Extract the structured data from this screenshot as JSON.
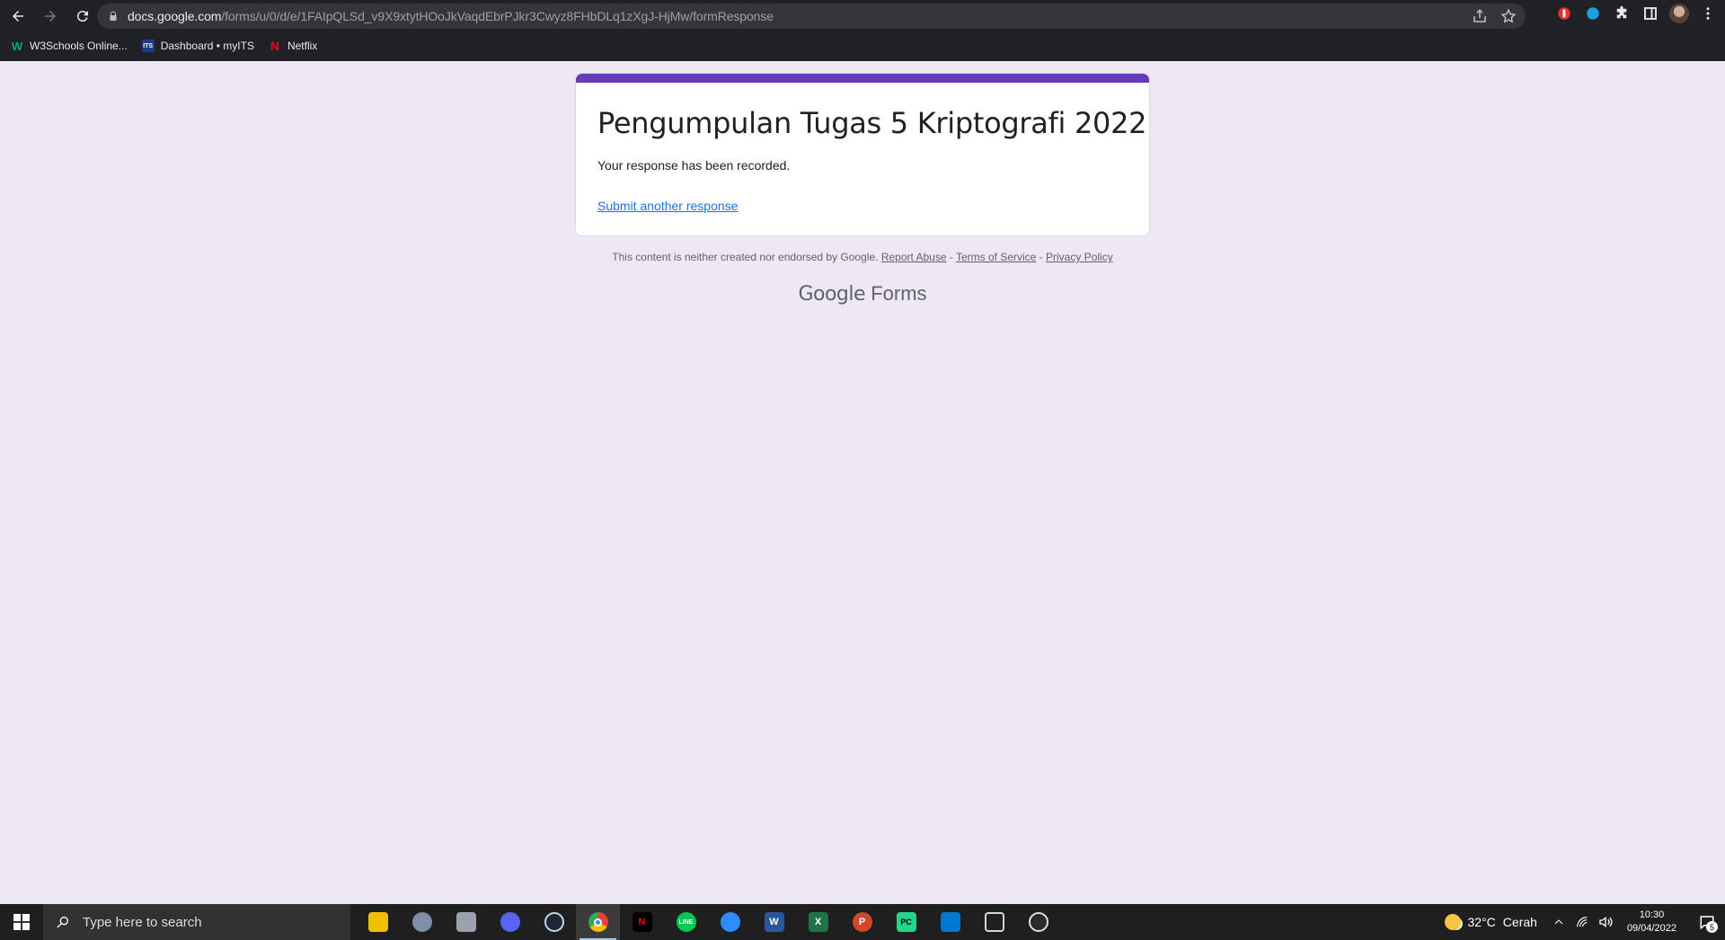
{
  "browser": {
    "url_host": "docs.google.com",
    "url_path": "/forms/u/0/d/e/1FAIpQLSd_v9X9xtytHOoJkVaqdEbrPJkr3Cwyz8FHbDLq1zXgJ-HjMw/formResponse",
    "bookmarks": [
      {
        "label": "W3Schools Online...",
        "icon": "w3schools-icon"
      },
      {
        "label": "Dashboard • myITS",
        "icon": "its-icon"
      },
      {
        "label": "Netflix",
        "icon": "netflix-icon"
      }
    ]
  },
  "form": {
    "title": "Pengumpulan Tugas 5 Kriptografi 2022",
    "message": "Your response has been recorded.",
    "another_link": "Submit another response",
    "accent_color": "#673ab7"
  },
  "footer": {
    "disclaimer": "This content is neither created nor endorsed by Google.",
    "report_abuse": "Report Abuse",
    "terms": "Terms of Service",
    "privacy": "Privacy Policy",
    "sep1": " - ",
    "sep2": " - ",
    "logo_google": "Google",
    "logo_forms": "Forms"
  },
  "taskbar": {
    "search_placeholder": "Type here to search",
    "temperature": "32°C",
    "weather": "Cerah",
    "time": "10:30",
    "date": "09/04/2022",
    "notification_count": "5",
    "apps": [
      "file-explorer",
      "app-2",
      "app-3",
      "discord",
      "steam",
      "chrome",
      "netflix",
      "line",
      "zoom",
      "word",
      "excel",
      "powerpoint",
      "pycharm",
      "vscode",
      "virtualbox",
      "obs"
    ]
  }
}
